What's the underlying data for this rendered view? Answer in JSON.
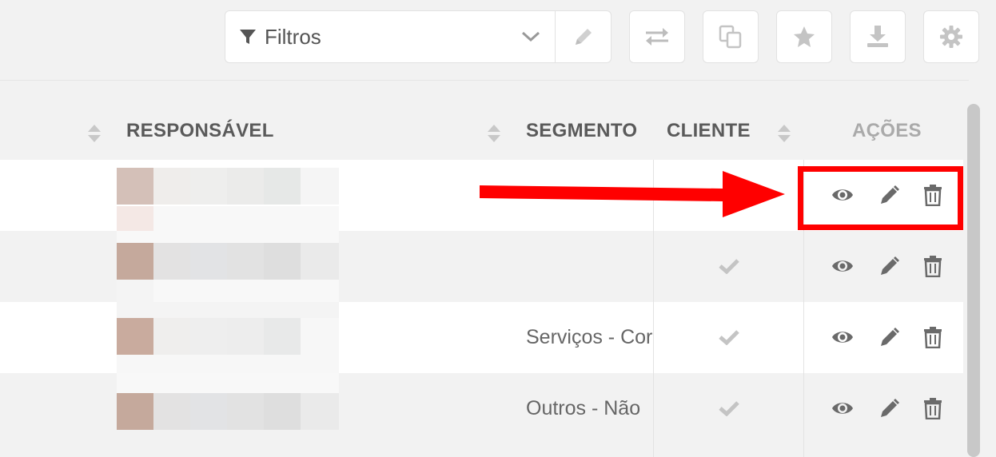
{
  "toolbar": {
    "filter_label": "Filtros",
    "filter_icon": "filter-icon",
    "dropdown_icon": "chevron-down-icon",
    "edit_filter_icon": "pencil-icon",
    "buttons": [
      "swap-icon",
      "copy-icon",
      "star-icon",
      "download-icon",
      "gear-icon"
    ]
  },
  "table": {
    "headers": {
      "responsavel": "RESPONSÁVEL",
      "segmento": "SEGMENTO",
      "cliente": "CLIENTE",
      "acoes": "AÇÕES"
    },
    "rows": [
      {
        "segmento": "",
        "cliente": false
      },
      {
        "segmento": "",
        "cliente": true
      },
      {
        "segmento": "Serviços - Cor",
        "cliente": true
      },
      {
        "segmento": "Outros - Não",
        "cliente": true
      }
    ],
    "row_actions": [
      "eye-icon",
      "pencil-icon",
      "trash-icon"
    ]
  },
  "colors": {
    "annotation": "#ff0000",
    "row_white": "#ffffff",
    "row_gray": "#f2f2f2",
    "icon_gray": "#777777",
    "check_gray": "#c4c4c4"
  }
}
